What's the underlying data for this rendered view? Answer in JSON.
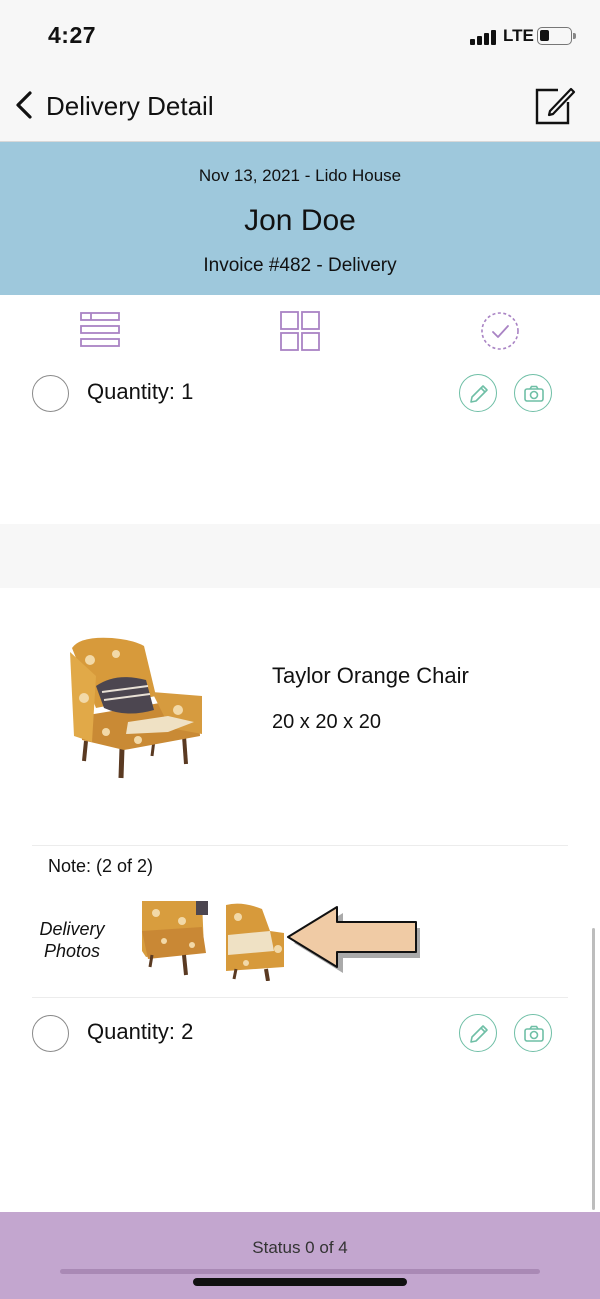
{
  "status_bar": {
    "time": "4:27",
    "network": "LTE"
  },
  "nav": {
    "title": "Delivery Detail",
    "back_icon": "chevron-left-icon",
    "compose_icon": "compose-icon"
  },
  "header": {
    "date_location": "Nov 13, 2021 - Lido House",
    "customer_name": "Jon Doe",
    "invoice": "Invoice #482 - Delivery",
    "background_color": "#9ec8dc"
  },
  "view_switcher": {
    "icons": [
      "list-view-icon",
      "grid-view-icon",
      "checklist-icon"
    ],
    "accent_color": "#a983c4"
  },
  "items": [
    {
      "quantity_label": "Quantity: 1"
    },
    {
      "name": "Taylor Orange Chair",
      "dimensions": "20 x 20 x 20",
      "note": "Note:  (2 of 2)",
      "photos_label_line1": "Delivery",
      "photos_label_line2": "Photos",
      "quantity_label": "Quantity: 2"
    }
  ],
  "actions": {
    "icons": [
      "pencil-icon",
      "camera-icon"
    ],
    "accent_color": "#6fbfa6"
  },
  "footer": {
    "status": "Status 0 of 4",
    "progress": 0,
    "background_color": "#c3a6cf"
  }
}
